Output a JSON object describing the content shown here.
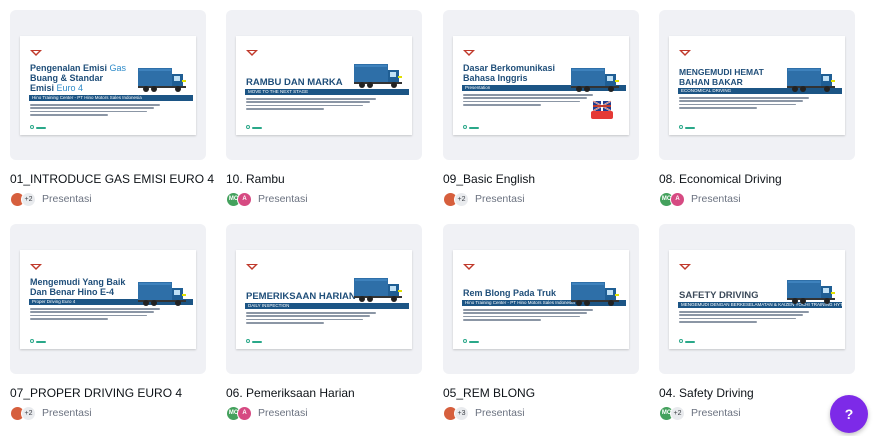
{
  "designs": [
    {
      "name": "01_INTRODUCE GAS EMISI EURO 4",
      "type_label": "Presentasi",
      "owners": [
        "photo"
      ],
      "extra_count": "+2",
      "thumbnail": {
        "title": "Pengenalan Emisi",
        "title_accent": "Gas",
        "title_line2": "Buang & Standar",
        "title_line3": "Emisi",
        "title_line3_accent": "Euro 4",
        "band": "Hino Training Center - PT Hino Motors Sales Indonesia",
        "style": "title-first"
      }
    },
    {
      "name": "10. Rambu",
      "type_label": "Presentasi",
      "owners": [
        "MC",
        "A"
      ],
      "extra_count": "",
      "thumbnail": {
        "title": "RAMBU DAN MARKA",
        "band": "MOVE TO THE NEXT STAGE",
        "style": "caps-low"
      }
    },
    {
      "name": "09_Basic English",
      "type_label": "Presentasi",
      "owners": [
        "photo"
      ],
      "extra_count": "+2",
      "thumbnail": {
        "title": "Dasar Berkomunikasi",
        "title_line2": "Bahasa Inggris",
        "band": "Presentation",
        "style": "title-first",
        "english_badge": true
      }
    },
    {
      "name": "08. Economical Driving",
      "type_label": "Presentasi",
      "owners": [
        "MC",
        "A"
      ],
      "extra_count": "",
      "thumbnail": {
        "title": "MENGEMUDI HEMAT",
        "title_line2": "BAHAN BAKAR",
        "band": "ECONOMICAL DRIVING",
        "style": "caps-two"
      }
    },
    {
      "name": "07_PROPER DRIVING EURO 4",
      "type_label": "Presentasi",
      "owners": [
        "photo"
      ],
      "extra_count": "+2",
      "thumbnail": {
        "title": "Mengemudi Yang Baik",
        "title_line2": "Dan Benar Hino E-4",
        "band": "Proper Driving Euro 4",
        "style": "title-first"
      }
    },
    {
      "name": "06. Pemeriksaan Harian",
      "type_label": "Presentasi",
      "owners": [
        "MC",
        "A"
      ],
      "extra_count": "",
      "thumbnail": {
        "title": "PEMERIKSAAN HARIAN",
        "band": "DAILY INSPECTION",
        "style": "caps-low"
      }
    },
    {
      "name": "05_REM BLONG",
      "type_label": "Presentasi",
      "owners": [
        "photo"
      ],
      "extra_count": "+3",
      "thumbnail": {
        "title": "Rem Blong Pada Truk",
        "band": "Hino Training Center - PT Hino Motors Sales Indonesia",
        "style": "title-first"
      }
    },
    {
      "name": "04. Safety Driving",
      "type_label": "Presentasi",
      "owners": [
        "MC"
      ],
      "extra_count": "+2",
      "thumbnail": {
        "title": "SAFETY DRIVING",
        "band": "MENGEMUDI DENGAN BERKESELAMATAN & KAIZEN YOCHI TRAINING HYTE",
        "style": "caps-gray"
      }
    }
  ],
  "help_button": {
    "label": "?"
  },
  "colors": {
    "brand_navy": "#1f4e79",
    "band_blue": "#1c5585",
    "accent_purple": "#7d2ae8",
    "avatar_green": "#44a15d",
    "avatar_pink": "#d64a82"
  }
}
